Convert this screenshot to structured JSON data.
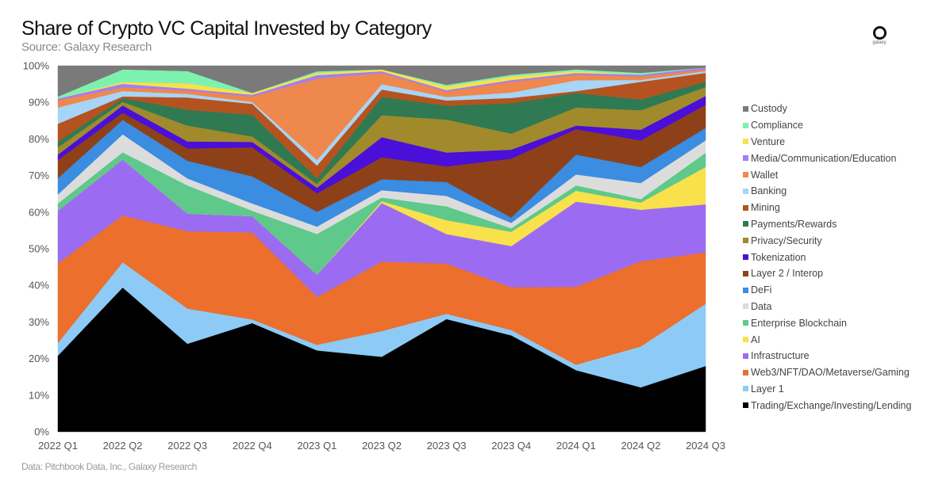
{
  "header": {
    "title": "Share of Crypto VC Capital Invested by Category",
    "subtitle": "Source: Galaxy Research",
    "logo_text": "galaxy"
  },
  "footer": {
    "note": "Data: Pitchbook Data, Inc., Galaxy Research"
  },
  "chart_data": {
    "type": "area",
    "stacked": true,
    "normalized": true,
    "title": "Share of Crypto VC Capital Invested by Category",
    "xlabel": "",
    "ylabel": "",
    "ylim": [
      0,
      100
    ],
    "y_ticks": [
      "0%",
      "10%",
      "20%",
      "30%",
      "40%",
      "50%",
      "60%",
      "70%",
      "80%",
      "90%",
      "100%"
    ],
    "grid": false,
    "legend_position": "right",
    "categories": [
      "2022 Q1",
      "2022 Q2",
      "2022 Q3",
      "2022 Q4",
      "2023 Q1",
      "2023 Q2",
      "2023 Q3",
      "2023 Q4",
      "2024 Q1",
      "2024 Q2",
      "2024 Q3"
    ],
    "series": [
      {
        "name": "Trading/Exchange/Investing/Lending",
        "color": "#000000",
        "values": [
          21,
          40,
          25,
          30,
          22,
          20.5,
          32.5,
          27,
          17,
          12.5,
          18.5
        ]
      },
      {
        "name": "Layer 1",
        "color": "#8dcbf6",
        "values": [
          3.5,
          7,
          10,
          1,
          1.5,
          7,
          1.5,
          1.5,
          1.5,
          11.5,
          17.5
        ]
      },
      {
        "name": "Web3/NFT/DAO/Metaverse/Gaming",
        "color": "#ec6f2d",
        "values": [
          22,
          13,
          22,
          24,
          13,
          19,
          14.5,
          12,
          21.5,
          24,
          14.5
        ]
      },
      {
        "name": "Infrastructure",
        "color": "#9b6cf2",
        "values": [
          14.5,
          15.5,
          5,
          4.5,
          6,
          16,
          8.5,
          11.5,
          23.5,
          14.5,
          13.5
        ]
      },
      {
        "name": "AI",
        "color": "#f9e14b",
        "values": [
          0,
          0,
          0,
          0,
          0,
          0.5,
          4,
          4,
          3,
          2,
          10.5
        ]
      },
      {
        "name": "Enterprise Blockchain",
        "color": "#5ec98a",
        "values": [
          2,
          2,
          8,
          1.5,
          11,
          1,
          4,
          1,
          1.5,
          1,
          4
        ]
      },
      {
        "name": "Data",
        "color": "#dcdcdc",
        "values": [
          2.5,
          5,
          2,
          2,
          2,
          2,
          3,
          1.5,
          3,
          4.5,
          3.5
        ]
      },
      {
        "name": "DeFi",
        "color": "#3a8de0",
        "values": [
          4.5,
          4,
          5,
          7.5,
          4,
          3,
          4,
          1.5,
          5.5,
          4.5,
          3.5
        ]
      },
      {
        "name": "Layer 2 / Interop",
        "color": "#8e4118",
        "values": [
          5,
          2,
          3.5,
          8,
          5,
          6,
          4.5,
          16.5,
          7,
          7.5,
          6.5
        ]
      },
      {
        "name": "Tokenization",
        "color": "#4a0fd8",
        "values": [
          1.5,
          2,
          2,
          1.5,
          1.5,
          5.5,
          4,
          2.5,
          1,
          3,
          2.5
        ]
      },
      {
        "name": "Privacy/Security",
        "color": "#a08a2b",
        "values": [
          2,
          1,
          4.5,
          1.5,
          1,
          6,
          9.5,
          4.5,
          5,
          5.5,
          2.5
        ]
      },
      {
        "name": "Payments/Rewards",
        "color": "#2f7a53",
        "values": [
          1.5,
          1,
          4.5,
          6,
          1.5,
          5,
          4,
          8.5,
          4,
          3,
          1.5
        ]
      },
      {
        "name": "Mining",
        "color": "#b4531f",
        "values": [
          5,
          0.5,
          3.5,
          3,
          3.5,
          2,
          1.5,
          1.5,
          0.5,
          5,
          2.5
        ]
      },
      {
        "name": "Banking",
        "color": "#a7d5f7",
        "values": [
          4.5,
          1.5,
          1,
          0.5,
          1.5,
          1.5,
          1,
          1.5,
          3,
          0.5,
          0.5
        ]
      },
      {
        "name": "Wallet",
        "color": "#ef884c",
        "values": [
          2,
          1,
          1,
          1.5,
          22,
          3,
          1.5,
          3,
          1.5,
          1,
          0.5
        ]
      },
      {
        "name": "Media/Communication/Education",
        "color": "#a27ff2",
        "values": [
          0.5,
          1,
          0.5,
          0.5,
          1,
          0.5,
          0.5,
          0.5,
          0.5,
          0.5,
          0.5
        ]
      },
      {
        "name": "Venture",
        "color": "#f9e14b",
        "values": [
          0,
          0.5,
          1.5,
          0.5,
          0.5,
          0.5,
          1,
          1,
          0.5,
          0,
          0
        ]
      },
      {
        "name": "Compliance",
        "color": "#7df2ae",
        "values": [
          0.5,
          3.5,
          3.5,
          0,
          0.5,
          0,
          0.5,
          0.5,
          0.5,
          0.5,
          0
        ],
        "note": "thin band"
      },
      {
        "name": "Custody",
        "color": "#7a7a7a",
        "values": [
          8.5,
          1,
          1.5,
          7.5,
          1.5,
          1,
          5.5,
          2.5,
          1,
          2,
          0.5
        ]
      }
    ]
  }
}
